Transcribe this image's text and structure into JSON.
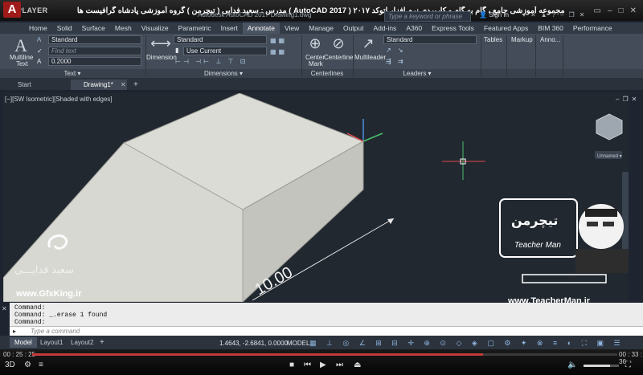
{
  "player": {
    "logo": "KMPLAYER",
    "title": "مجموعه آموزشی جامع ، گام به گام و کاربردی نرم افزار   اتوکد ۲۰۱۷ ( AutoCAD 2017 )   مدرس : سعید فدایی ( تیچرمن ) گروه آموزشی پادشاه گرافیست ها",
    "elapsed": "00 : 25 : 25",
    "total": "00 : 33 : 36",
    "progress_fraction": 0.77,
    "volume_fraction": 0.75
  },
  "autocad": {
    "logo_letter": "A",
    "app_title": "Autodesk AutoCAD 2017   Drawing1.dwg",
    "search_placeholder": "Type a keyword or phrase",
    "signin": "Sign In",
    "ribbon_tabs": [
      "Home",
      "Solid",
      "Surface",
      "Mesh",
      "Visualize",
      "Parametric",
      "Insert",
      "Annotate",
      "View",
      "Manage",
      "Output",
      "Add-ins",
      "A360",
      "Express Tools",
      "Featured Apps",
      "BIM 360",
      "Performance"
    ],
    "active_tab": "Annotate",
    "text_panel": {
      "multiline_label": "Multiline",
      "multiline_label2": "Text",
      "style": "Standard",
      "find_placeholder": "Find text",
      "height": "0.2000",
      "panel_label": "Text ▾"
    },
    "dimensions_panel": {
      "big_label": "Dimension",
      "style": "Standard",
      "layer": "Use Current",
      "panel_label": "Dimensions ▾"
    },
    "centerlines_panel": {
      "center_mark_1": "Center",
      "center_mark_2": "Mark",
      "centerline": "Centerline",
      "panel_label": "Centerlines"
    },
    "leaders_panel": {
      "multileader": "Multileader",
      "style": "Standard",
      "panel_label": "Leaders ▾"
    },
    "tables_label": "Tables",
    "markup_label": "Markup",
    "anno_label": "Anno...",
    "file_tabs": [
      "Start",
      "Drawing1*"
    ],
    "active_file": "Drawing1*",
    "viewport_label": "[−][SW Isometric][Shaded with edges]",
    "viewcube_label": "Unnamed ▾",
    "dimension_text": "10.00",
    "command_lines": [
      "Command:",
      "Command: _.erase 1 found",
      "Command:"
    ],
    "command_placeholder": "Type a command",
    "layout_tabs": [
      "Model",
      "Layout1",
      "Layout2"
    ],
    "active_layout": "Model",
    "coordinates": "1.4643, -2.6841, 0.0000",
    "space": "MODEL"
  },
  "watermarks": {
    "left_name": "سعید فدایـــی",
    "left_url": "www.GfxKing.ir",
    "right_brand": "تیچرمن",
    "right_brand_en": "Teacher Man",
    "right_url": "www.TeacherMan.ir"
  },
  "colors": {
    "seek_fill": "#c23a3a",
    "model_face_light": "#dcdcd6",
    "model_face_dark": "#b9b9b3",
    "axis_x": "#e04848",
    "axis_y": "#49c06a",
    "axis_z": "#4f8fe0"
  }
}
